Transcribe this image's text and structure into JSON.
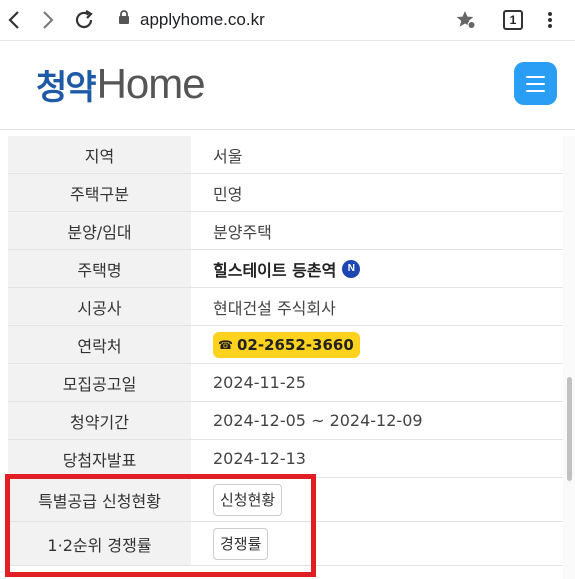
{
  "browser": {
    "url": "applyhome.co.kr",
    "tab_count": "1",
    "icons": [
      "back-icon",
      "forward-icon",
      "reload-icon",
      "lock-icon",
      "star-icon",
      "more-vert-icon"
    ]
  },
  "site": {
    "logo_kr": "청약",
    "logo_en": "Home",
    "accent_color": "#2a9df4",
    "logo_color": "#1f5aa6"
  },
  "info": {
    "rows": [
      {
        "label": "지역",
        "value": "서울"
      },
      {
        "label": "주택구분",
        "value": "민영"
      },
      {
        "label": "분양/임대",
        "value": "분양주택"
      },
      {
        "label": "주택명",
        "value": "힐스테이트 등촌역",
        "badge": "N"
      },
      {
        "label": "시공사",
        "value": "현대건설 주식회사"
      },
      {
        "label": "연락처",
        "value": "02-2652-3660"
      },
      {
        "label": "모집공고일",
        "value": "2024-11-25"
      },
      {
        "label": "청약기간",
        "value": "2024-12-05 ~ 2024-12-09"
      },
      {
        "label": "당첨자발표",
        "value": "2024-12-13"
      },
      {
        "label": "특별공급 신청현황",
        "button": "신청현황"
      },
      {
        "label": "1·2순위 경쟁률",
        "button": "경쟁률"
      }
    ],
    "phone_color": "#ffd21e",
    "highlight_color": "#e01e24"
  }
}
